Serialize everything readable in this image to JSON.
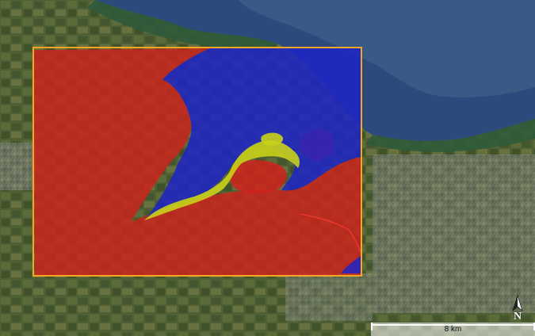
{
  "map": {
    "basemap": "satellite-imagery",
    "colors": {
      "sea": "#2c4a7c",
      "sea_shallow": "#3a5a86",
      "coast_vegetation": "#2e5a3a",
      "land": "#4f6034",
      "urban": "#8a8a7e",
      "class_red": "#d0221c",
      "class_blue": "#1d23c8",
      "class_yellow": "#c9d21a",
      "frame_outline": "#f5a623"
    },
    "legend_classes": [
      "red",
      "blue",
      "yellow"
    ]
  },
  "scale_bar": {
    "label": "8 km"
  },
  "north_arrow": {
    "label": "N",
    "icon": "north-arrow-icon"
  }
}
